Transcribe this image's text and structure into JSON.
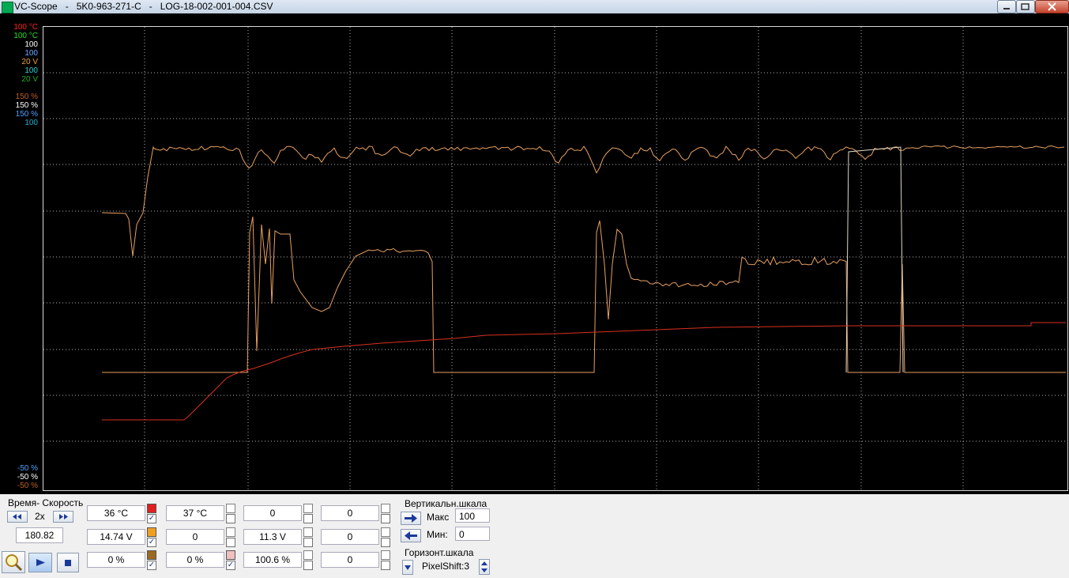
{
  "window": {
    "title": "VC-Scope   -   5K0-963-271-C   -   LOG-18-002-001-004.CSV"
  },
  "scope": {
    "axis_labels_top": [
      {
        "text": "100 °C",
        "color": "#ff2020"
      },
      {
        "text": "100 °C",
        "color": "#20e020"
      },
      {
        "text": "100",
        "color": "#ffffff"
      },
      {
        "text": "100",
        "color": "#6aa8ff"
      },
      {
        "text": "20 V",
        "color": "#e8a040"
      },
      {
        "text": "100",
        "color": "#20d0d0"
      },
      {
        "text": "20 V",
        "color": "#20b020"
      }
    ],
    "axis_labels_mid": [
      {
        "text": "150 %",
        "color": "#c06020"
      },
      {
        "text": "150 %",
        "color": "#ffffff"
      },
      {
        "text": "150 %",
        "color": "#4aa0ff"
      },
      {
        "text": "100",
        "color": "#20b0d0"
      }
    ],
    "axis_labels_bottom": [
      {
        "text": "-50 %",
        "color": "#4aa0ff"
      },
      {
        "text": "-50 %",
        "color": "#ffffff"
      },
      {
        "text": "-50 %",
        "color": "#c06020"
      }
    ]
  },
  "colors": {
    "trace_orange": "#e8a060",
    "trace_red": "#d83020",
    "trace_white": "#e0d8c8",
    "grid": "#b0b0b0"
  },
  "controls": {
    "time_speed_label": "Время- Скорость",
    "speed_value": "2x",
    "time_value": "180.82",
    "channels": [
      {
        "value": "36 °C",
        "swatch": "#e02020",
        "checked": true
      },
      {
        "value": "37 °C",
        "swatch": "",
        "checked": false
      },
      {
        "value": "0",
        "swatch": "",
        "checked": false
      },
      {
        "value": "0",
        "swatch": "",
        "checked": false
      },
      {
        "value": "14.74 V",
        "swatch": "#f0a020",
        "checked": true
      },
      {
        "value": "0",
        "swatch": "",
        "checked": false
      },
      {
        "value": "11.3 V",
        "swatch": "",
        "checked": false
      },
      {
        "value": "0",
        "swatch": "",
        "checked": false
      },
      {
        "value": "0 %",
        "swatch": "#9a6a20",
        "checked": true
      },
      {
        "value": "0 %",
        "swatch": "#f0c0c0",
        "checked": true
      },
      {
        "value": "100.6 %",
        "swatch": "",
        "checked": false
      },
      {
        "value": "0",
        "swatch": "",
        "checked": false
      }
    ],
    "vertical_scale_label": "Вертикальн.шкала",
    "max_label": "Макс",
    "max_value": "100",
    "min_label": "Мин:",
    "min_value": "0",
    "horizontal_scale_label": "Горизонт.шкала",
    "pixelshift_value": "PixelShift:3"
  }
}
